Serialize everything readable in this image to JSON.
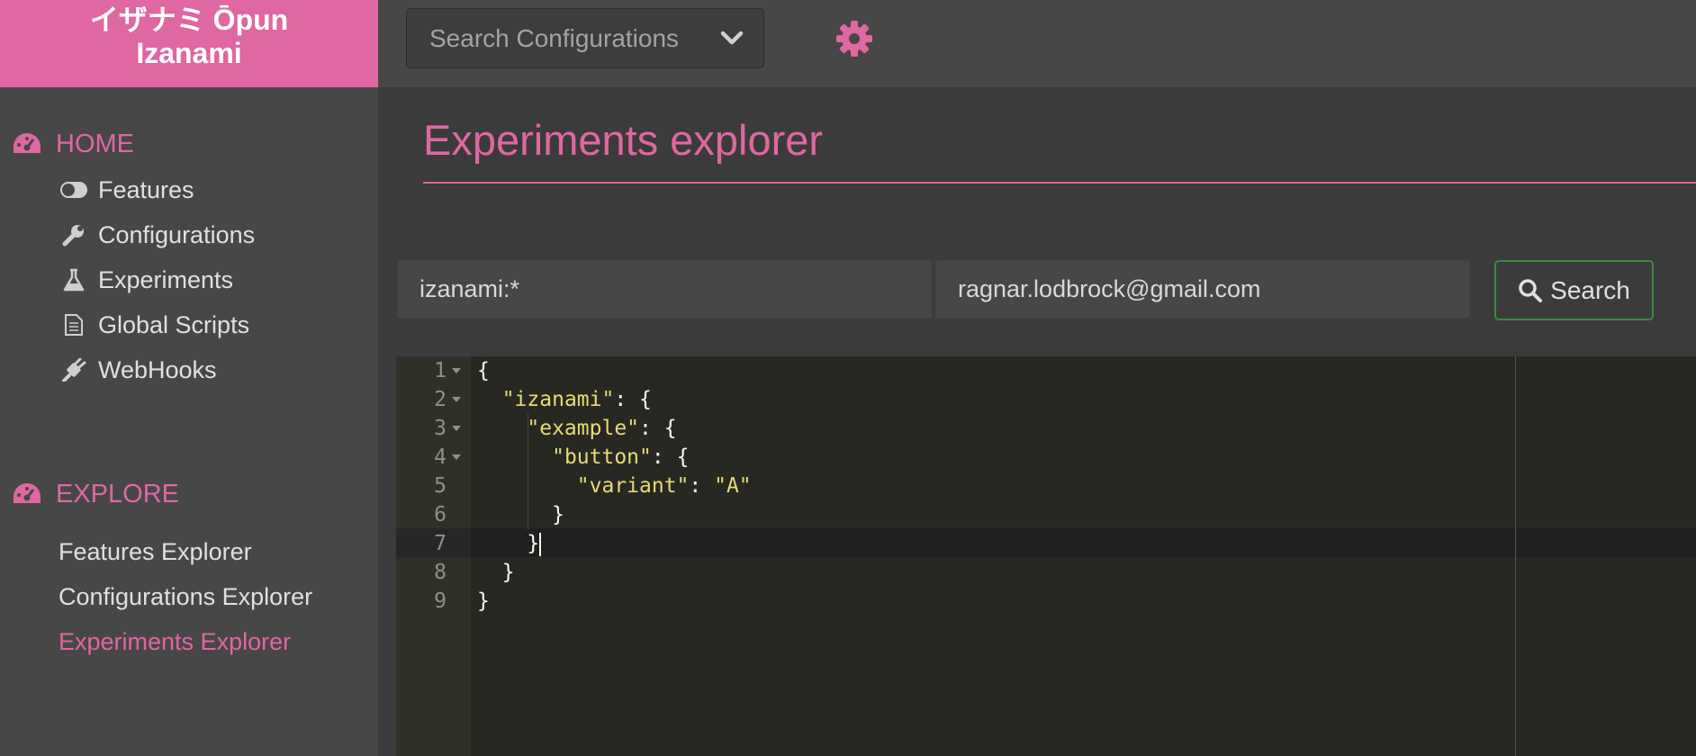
{
  "brand": {
    "line1": "イザナミ Ōpun",
    "line2": "Izanami"
  },
  "header": {
    "config_search_placeholder": "Search Configurations",
    "settings_icon": "gear-icon"
  },
  "sidebar": {
    "home_label": "HOME",
    "home_items": [
      {
        "label": "Features",
        "icon": "toggle-icon"
      },
      {
        "label": "Configurations",
        "icon": "wrench-icon"
      },
      {
        "label": "Experiments",
        "icon": "flask-icon"
      },
      {
        "label": "Global Scripts",
        "icon": "file-icon"
      },
      {
        "label": "WebHooks",
        "icon": "plug-icon"
      }
    ],
    "explore_label": "EXPLORE",
    "explore_items": [
      {
        "label": "Features Explorer"
      },
      {
        "label": "Configurations Explorer"
      },
      {
        "label": "Experiments Explorer",
        "active": true
      }
    ]
  },
  "main": {
    "title": "Experiments explorer",
    "pattern_value": "izanami:*",
    "client_id_value": "ragnar.lodbrock@gmail.com",
    "search_button_label": "Search"
  },
  "editor": {
    "line_numbers": [
      "1",
      "2",
      "3",
      "4",
      "5",
      "6",
      "7",
      "8",
      "9"
    ],
    "lines": [
      {
        "parts": [
          {
            "t": "{",
            "c": "p"
          }
        ]
      },
      {
        "parts": [
          {
            "t": "  ",
            "c": "p"
          },
          {
            "t": "\"izanami\"",
            "c": "s"
          },
          {
            "t": ": {",
            "c": "p"
          }
        ]
      },
      {
        "parts": [
          {
            "t": "    ",
            "c": "p"
          },
          {
            "t": "\"example\"",
            "c": "s"
          },
          {
            "t": ": {",
            "c": "p"
          }
        ]
      },
      {
        "parts": [
          {
            "t": "      ",
            "c": "p"
          },
          {
            "t": "\"button\"",
            "c": "s"
          },
          {
            "t": ": {",
            "c": "p"
          }
        ]
      },
      {
        "parts": [
          {
            "t": "        ",
            "c": "p"
          },
          {
            "t": "\"variant\"",
            "c": "s"
          },
          {
            "t": ": ",
            "c": "p"
          },
          {
            "t": "\"A\"",
            "c": "s"
          }
        ]
      },
      {
        "parts": [
          {
            "t": "      }",
            "c": "p"
          }
        ]
      },
      {
        "parts": [
          {
            "t": "    }",
            "c": "p"
          }
        ]
      },
      {
        "parts": [
          {
            "t": "  }",
            "c": "p"
          }
        ]
      },
      {
        "parts": [
          {
            "t": "}",
            "c": "p"
          }
        ]
      }
    ],
    "foldable": [
      1,
      2,
      3,
      4
    ],
    "active_line": 7
  },
  "colors": {
    "accent": "#df67a2",
    "button_border": "#3c8a3e",
    "editor_bg": "#272822",
    "string": "#e6db74"
  }
}
